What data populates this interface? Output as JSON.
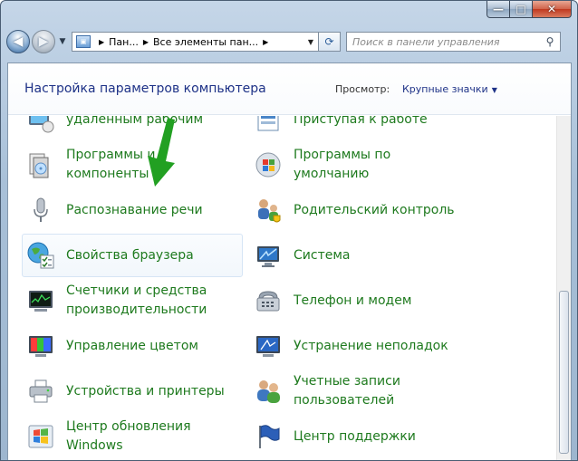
{
  "window": {
    "caption_min": "—",
    "caption_max": "□",
    "caption_close": "✕"
  },
  "nav": {
    "back_glyph": "◀",
    "forward_glyph": "▶",
    "breadcrumbs": [
      "Пан...",
      "Все элементы пан..."
    ],
    "search_placeholder": "Поиск в панели управления"
  },
  "header": {
    "title": "Настройка параметров компьютера",
    "view_label": "Просмотр:",
    "view_value": "Крупные значки"
  },
  "items": [
    {
      "label": "удаленным рабочим",
      "icon": "remote-desktop-icon"
    },
    {
      "label": "Приступая к работе",
      "icon": "getting-started-icon"
    },
    {
      "label": "Программы и компоненты",
      "icon": "programs-features-icon"
    },
    {
      "label": "Программы по умолчанию",
      "icon": "default-programs-icon"
    },
    {
      "label": "Распознавание речи",
      "icon": "microphone-icon"
    },
    {
      "label": "Родительский контроль",
      "icon": "parental-control-icon"
    },
    {
      "label": "Свойства браузера",
      "icon": "internet-options-icon"
    },
    {
      "label": "Система",
      "icon": "system-icon"
    },
    {
      "label": "Счетчики и средства производительности",
      "icon": "performance-icon"
    },
    {
      "label": "Телефон и модем",
      "icon": "phone-modem-icon"
    },
    {
      "label": "Управление цветом",
      "icon": "color-management-icon"
    },
    {
      "label": "Устранение неполадок",
      "icon": "troubleshooting-icon"
    },
    {
      "label": "Устройства и принтеры",
      "icon": "devices-printers-icon"
    },
    {
      "label": "Учетные записи пользователей",
      "icon": "user-accounts-icon"
    },
    {
      "label": "Центр обновления Windows",
      "icon": "windows-update-icon"
    },
    {
      "label": "Центр поддержки",
      "icon": "action-center-icon"
    }
  ],
  "colors": {
    "link_green": "#1e7a1e",
    "title_blue": "#1e3287",
    "arrow_green": "#22a022"
  }
}
